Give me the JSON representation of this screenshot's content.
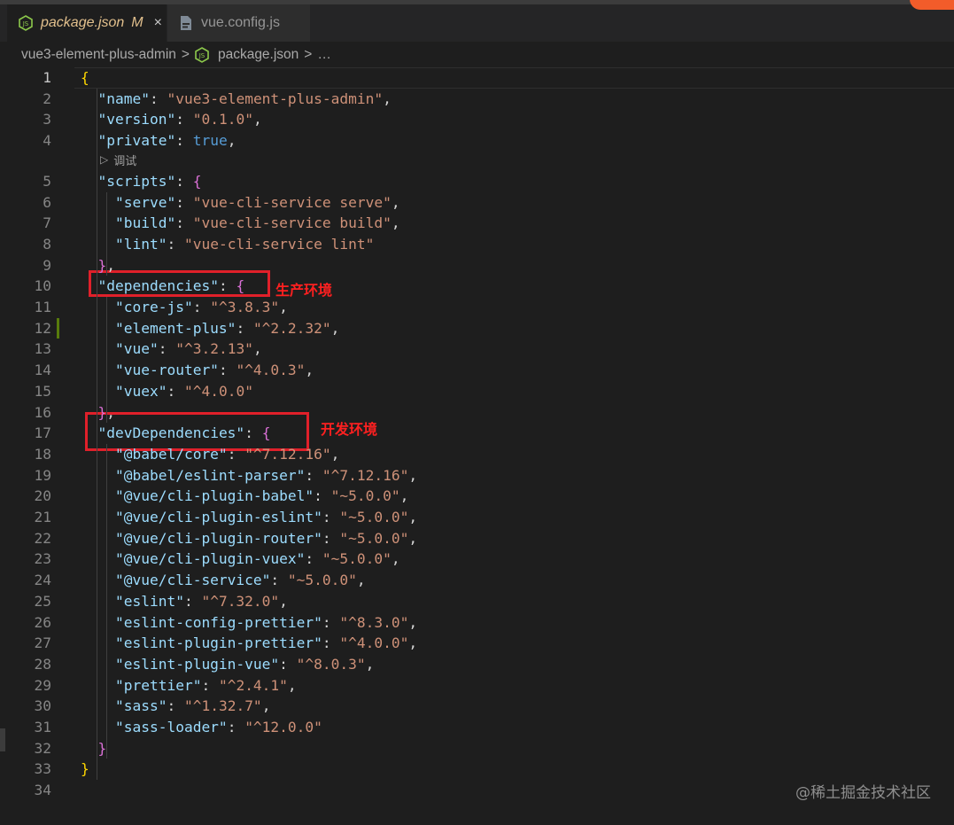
{
  "tabs": [
    {
      "label": "package.json",
      "modified_flag": "M",
      "close": "×",
      "icon": "nodejs-icon"
    },
    {
      "label": "vue.config.js",
      "icon": "js-file-icon"
    }
  ],
  "breadcrumb": {
    "folder": "vue3-element-plus-admin",
    "file": "package.json",
    "more": "…",
    "separator": ">"
  },
  "codelens": {
    "label": "调试",
    "icon": "play-icon"
  },
  "annotations": {
    "dependencies_note": "生产环境",
    "dev_dependencies_note": "开发环境"
  },
  "watermark": "@稀土掘金技术社区",
  "lines": [
    {
      "n": "1",
      "t": [
        [
          "br1",
          "{"
        ]
      ]
    },
    {
      "n": "2",
      "t": [
        [
          "p",
          "  "
        ],
        [
          "k",
          "\"name\""
        ],
        [
          "p",
          ": "
        ],
        [
          "s",
          "\"vue3-element-plus-admin\""
        ],
        [
          "p",
          ","
        ]
      ]
    },
    {
      "n": "3",
      "t": [
        [
          "p",
          "  "
        ],
        [
          "k",
          "\"version\""
        ],
        [
          "p",
          ": "
        ],
        [
          "s",
          "\"0.1.0\""
        ],
        [
          "p",
          ","
        ]
      ]
    },
    {
      "n": "4",
      "t": [
        [
          "p",
          "  "
        ],
        [
          "k",
          "\"private\""
        ],
        [
          "p",
          ": "
        ],
        [
          "b",
          "true"
        ],
        [
          "p",
          ","
        ]
      ]
    },
    {
      "n": "5",
      "t": [
        [
          "p",
          "  "
        ],
        [
          "k",
          "\"scripts\""
        ],
        [
          "p",
          ": "
        ],
        [
          "br2",
          "{"
        ]
      ]
    },
    {
      "n": "6",
      "t": [
        [
          "p",
          "    "
        ],
        [
          "k",
          "\"serve\""
        ],
        [
          "p",
          ": "
        ],
        [
          "s",
          "\"vue-cli-service serve\""
        ],
        [
          "p",
          ","
        ]
      ]
    },
    {
      "n": "7",
      "t": [
        [
          "p",
          "    "
        ],
        [
          "k",
          "\"build\""
        ],
        [
          "p",
          ": "
        ],
        [
          "s",
          "\"vue-cli-service build\""
        ],
        [
          "p",
          ","
        ]
      ]
    },
    {
      "n": "8",
      "t": [
        [
          "p",
          "    "
        ],
        [
          "k",
          "\"lint\""
        ],
        [
          "p",
          ": "
        ],
        [
          "s",
          "\"vue-cli-service lint\""
        ]
      ]
    },
    {
      "n": "9",
      "t": [
        [
          "p",
          "  "
        ],
        [
          "br2",
          "}"
        ],
        [
          "p",
          ","
        ]
      ]
    },
    {
      "n": "10",
      "t": [
        [
          "p",
          "  "
        ],
        [
          "k",
          "\"dependencies\""
        ],
        [
          "p",
          ": "
        ],
        [
          "br2",
          "{"
        ]
      ]
    },
    {
      "n": "11",
      "t": [
        [
          "p",
          "    "
        ],
        [
          "k",
          "\"core-js\""
        ],
        [
          "p",
          ": "
        ],
        [
          "s",
          "\"^3.8.3\""
        ],
        [
          "p",
          ","
        ]
      ]
    },
    {
      "n": "12",
      "t": [
        [
          "p",
          "    "
        ],
        [
          "k",
          "\"element-plus\""
        ],
        [
          "p",
          ": "
        ],
        [
          "s",
          "\"^2.2.32\""
        ],
        [
          "p",
          ","
        ]
      ]
    },
    {
      "n": "13",
      "t": [
        [
          "p",
          "    "
        ],
        [
          "k",
          "\"vue\""
        ],
        [
          "p",
          ": "
        ],
        [
          "s",
          "\"^3.2.13\""
        ],
        [
          "p",
          ","
        ]
      ]
    },
    {
      "n": "14",
      "t": [
        [
          "p",
          "    "
        ],
        [
          "k",
          "\"vue-router\""
        ],
        [
          "p",
          ": "
        ],
        [
          "s",
          "\"^4.0.3\""
        ],
        [
          "p",
          ","
        ]
      ]
    },
    {
      "n": "15",
      "t": [
        [
          "p",
          "    "
        ],
        [
          "k",
          "\"vuex\""
        ],
        [
          "p",
          ": "
        ],
        [
          "s",
          "\"^4.0.0\""
        ]
      ]
    },
    {
      "n": "16",
      "t": [
        [
          "p",
          "  "
        ],
        [
          "br2",
          "}"
        ],
        [
          "p",
          ","
        ]
      ]
    },
    {
      "n": "17",
      "t": [
        [
          "p",
          "  "
        ],
        [
          "k",
          "\"devDependencies\""
        ],
        [
          "p",
          ": "
        ],
        [
          "br2",
          "{"
        ]
      ]
    },
    {
      "n": "18",
      "t": [
        [
          "p",
          "    "
        ],
        [
          "k",
          "\"@babel/core\""
        ],
        [
          "p",
          ": "
        ],
        [
          "s",
          "\"^7.12.16\""
        ],
        [
          "p",
          ","
        ]
      ]
    },
    {
      "n": "19",
      "t": [
        [
          "p",
          "    "
        ],
        [
          "k",
          "\"@babel/eslint-parser\""
        ],
        [
          "p",
          ": "
        ],
        [
          "s",
          "\"^7.12.16\""
        ],
        [
          "p",
          ","
        ]
      ]
    },
    {
      "n": "20",
      "t": [
        [
          "p",
          "    "
        ],
        [
          "k",
          "\"@vue/cli-plugin-babel\""
        ],
        [
          "p",
          ": "
        ],
        [
          "s",
          "\"~5.0.0\""
        ],
        [
          "p",
          ","
        ]
      ]
    },
    {
      "n": "21",
      "t": [
        [
          "p",
          "    "
        ],
        [
          "k",
          "\"@vue/cli-plugin-eslint\""
        ],
        [
          "p",
          ": "
        ],
        [
          "s",
          "\"~5.0.0\""
        ],
        [
          "p",
          ","
        ]
      ]
    },
    {
      "n": "22",
      "t": [
        [
          "p",
          "    "
        ],
        [
          "k",
          "\"@vue/cli-plugin-router\""
        ],
        [
          "p",
          ": "
        ],
        [
          "s",
          "\"~5.0.0\""
        ],
        [
          "p",
          ","
        ]
      ]
    },
    {
      "n": "23",
      "t": [
        [
          "p",
          "    "
        ],
        [
          "k",
          "\"@vue/cli-plugin-vuex\""
        ],
        [
          "p",
          ": "
        ],
        [
          "s",
          "\"~5.0.0\""
        ],
        [
          "p",
          ","
        ]
      ]
    },
    {
      "n": "24",
      "t": [
        [
          "p",
          "    "
        ],
        [
          "k",
          "\"@vue/cli-service\""
        ],
        [
          "p",
          ": "
        ],
        [
          "s",
          "\"~5.0.0\""
        ],
        [
          "p",
          ","
        ]
      ]
    },
    {
      "n": "25",
      "t": [
        [
          "p",
          "    "
        ],
        [
          "k",
          "\"eslint\""
        ],
        [
          "p",
          ": "
        ],
        [
          "s",
          "\"^7.32.0\""
        ],
        [
          "p",
          ","
        ]
      ]
    },
    {
      "n": "26",
      "t": [
        [
          "p",
          "    "
        ],
        [
          "k",
          "\"eslint-config-prettier\""
        ],
        [
          "p",
          ": "
        ],
        [
          "s",
          "\"^8.3.0\""
        ],
        [
          "p",
          ","
        ]
      ]
    },
    {
      "n": "27",
      "t": [
        [
          "p",
          "    "
        ],
        [
          "k",
          "\"eslint-plugin-prettier\""
        ],
        [
          "p",
          ": "
        ],
        [
          "s",
          "\"^4.0.0\""
        ],
        [
          "p",
          ","
        ]
      ]
    },
    {
      "n": "28",
      "t": [
        [
          "p",
          "    "
        ],
        [
          "k",
          "\"eslint-plugin-vue\""
        ],
        [
          "p",
          ": "
        ],
        [
          "s",
          "\"^8.0.3\""
        ],
        [
          "p",
          ","
        ]
      ]
    },
    {
      "n": "29",
      "t": [
        [
          "p",
          "    "
        ],
        [
          "k",
          "\"prettier\""
        ],
        [
          "p",
          ": "
        ],
        [
          "s",
          "\"^2.4.1\""
        ],
        [
          "p",
          ","
        ]
      ]
    },
    {
      "n": "30",
      "t": [
        [
          "p",
          "    "
        ],
        [
          "k",
          "\"sass\""
        ],
        [
          "p",
          ": "
        ],
        [
          "s",
          "\"^1.32.7\""
        ],
        [
          "p",
          ","
        ]
      ]
    },
    {
      "n": "31",
      "t": [
        [
          "p",
          "    "
        ],
        [
          "k",
          "\"sass-loader\""
        ],
        [
          "p",
          ": "
        ],
        [
          "s",
          "\"^12.0.0\""
        ]
      ]
    },
    {
      "n": "32",
      "t": [
        [
          "p",
          "  "
        ],
        [
          "br2",
          "}"
        ]
      ]
    },
    {
      "n": "33",
      "t": [
        [
          "br1",
          "}"
        ]
      ]
    },
    {
      "n": "34",
      "t": []
    }
  ]
}
